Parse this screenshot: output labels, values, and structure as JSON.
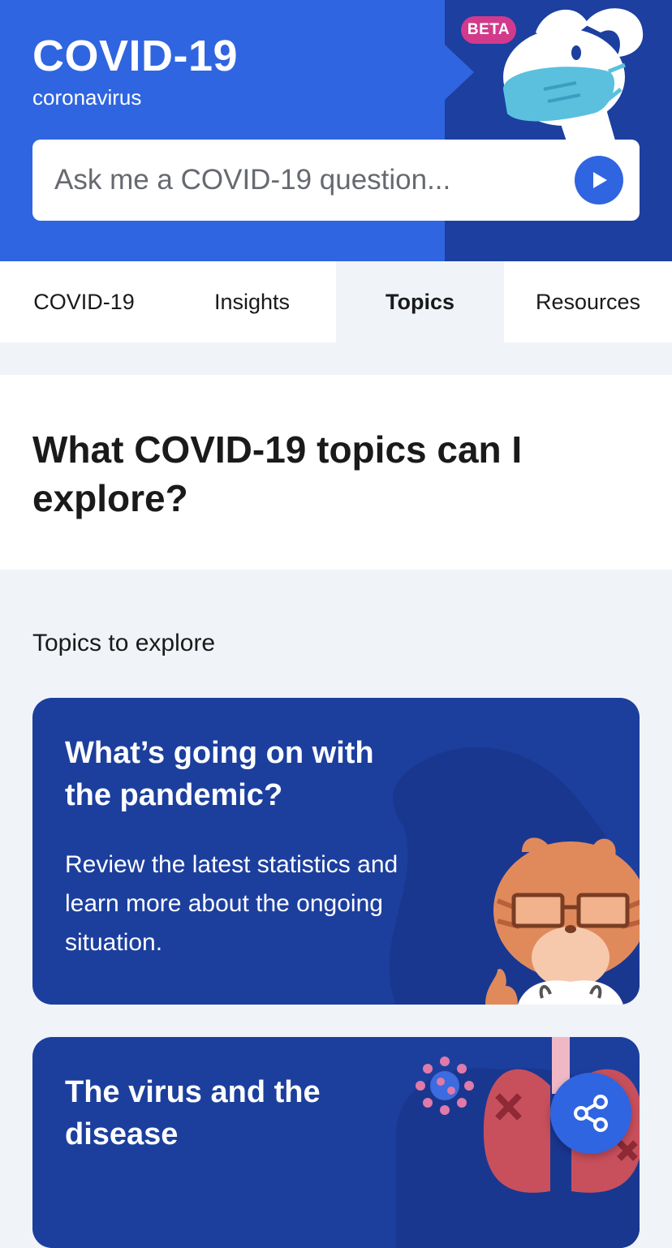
{
  "header": {
    "title": "COVID-19",
    "subtitle": "coronavirus",
    "badge": "BETA",
    "colors": {
      "primary": "#2f65e0",
      "dark": "#1c3fa0",
      "badge": "#d23a8c"
    }
  },
  "search": {
    "placeholder": "Ask me a COVID-19 question...",
    "submit_icon": "play-icon"
  },
  "tabs": [
    {
      "label": "COVID-19",
      "active": false
    },
    {
      "label": "Insights",
      "active": false
    },
    {
      "label": "Topics",
      "active": true
    },
    {
      "label": "Resources",
      "active": false
    }
  ],
  "question": {
    "title": "What COVID-19 topics can I explore?"
  },
  "topics": {
    "heading": "Topics to explore",
    "cards": [
      {
        "title": "What’s going on with the pandemic?",
        "description": "Review the latest statistics and learn more about the ongoing situation.",
        "illustration": "doctor-tiger-illustration"
      },
      {
        "title": "The virus and the disease",
        "illustration": "lungs-virus-illustration"
      }
    ]
  },
  "share_button": {
    "icon": "share-icon"
  }
}
